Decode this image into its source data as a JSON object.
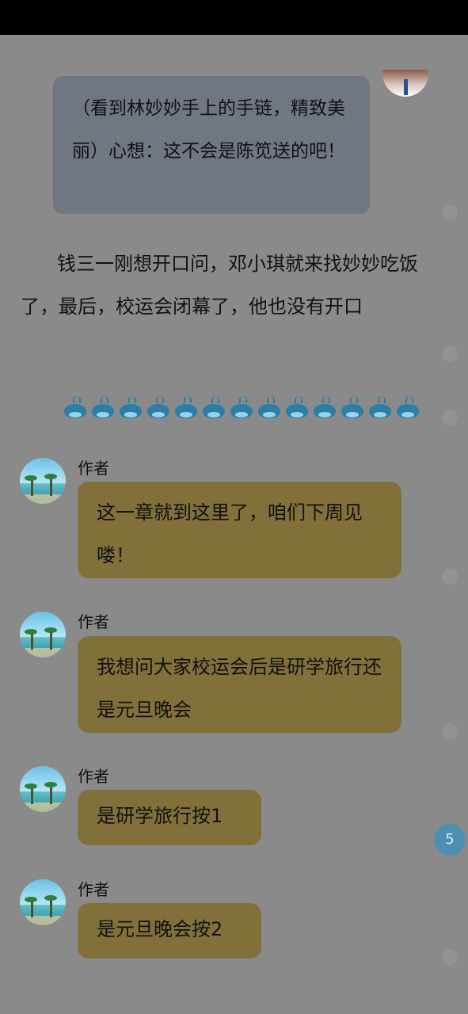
{
  "scene": {
    "user_message": "（看到林妙妙手上的手链，精致美丽）心想：这不会是陈笕送的吧！",
    "narration": "钱三一刚想开口问，邓小琪就来找妙妙吃饭了，最后，校运会闭幕了，他也没有开口",
    "divider_emoji": "whale"
  },
  "author_messages": [
    {
      "author": "作者",
      "text": "这一章就到这里了，咱们下周见喽！"
    },
    {
      "author": "作者",
      "text": "我想问大家校运会后是研学旅行还是元旦晚会"
    },
    {
      "author": "作者",
      "text": "是研学旅行按1"
    },
    {
      "author": "作者",
      "text": "是元旦晚会按2"
    }
  ],
  "comment_count": "5",
  "colors": {
    "author_bubble": "#82703b",
    "user_bubble": "#717780",
    "badge": "#4d8fb0",
    "overlay_bg": "#8a8a8a"
  }
}
